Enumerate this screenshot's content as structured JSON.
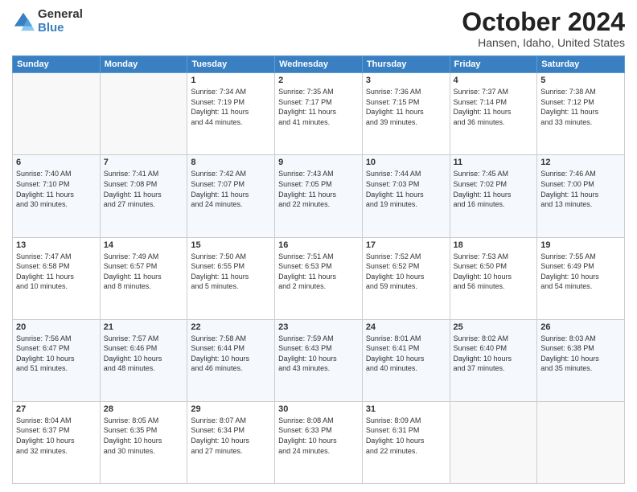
{
  "header": {
    "logo": {
      "general": "General",
      "blue": "Blue"
    },
    "title": "October 2024",
    "location": "Hansen, Idaho, United States"
  },
  "weekdays": [
    "Sunday",
    "Monday",
    "Tuesday",
    "Wednesday",
    "Thursday",
    "Friday",
    "Saturday"
  ],
  "weeks": [
    [
      {
        "day": "",
        "info": ""
      },
      {
        "day": "",
        "info": ""
      },
      {
        "day": "1",
        "info": "Sunrise: 7:34 AM\nSunset: 7:19 PM\nDaylight: 11 hours\nand 44 minutes."
      },
      {
        "day": "2",
        "info": "Sunrise: 7:35 AM\nSunset: 7:17 PM\nDaylight: 11 hours\nand 41 minutes."
      },
      {
        "day": "3",
        "info": "Sunrise: 7:36 AM\nSunset: 7:15 PM\nDaylight: 11 hours\nand 39 minutes."
      },
      {
        "day": "4",
        "info": "Sunrise: 7:37 AM\nSunset: 7:14 PM\nDaylight: 11 hours\nand 36 minutes."
      },
      {
        "day": "5",
        "info": "Sunrise: 7:38 AM\nSunset: 7:12 PM\nDaylight: 11 hours\nand 33 minutes."
      }
    ],
    [
      {
        "day": "6",
        "info": "Sunrise: 7:40 AM\nSunset: 7:10 PM\nDaylight: 11 hours\nand 30 minutes."
      },
      {
        "day": "7",
        "info": "Sunrise: 7:41 AM\nSunset: 7:08 PM\nDaylight: 11 hours\nand 27 minutes."
      },
      {
        "day": "8",
        "info": "Sunrise: 7:42 AM\nSunset: 7:07 PM\nDaylight: 11 hours\nand 24 minutes."
      },
      {
        "day": "9",
        "info": "Sunrise: 7:43 AM\nSunset: 7:05 PM\nDaylight: 11 hours\nand 22 minutes."
      },
      {
        "day": "10",
        "info": "Sunrise: 7:44 AM\nSunset: 7:03 PM\nDaylight: 11 hours\nand 19 minutes."
      },
      {
        "day": "11",
        "info": "Sunrise: 7:45 AM\nSunset: 7:02 PM\nDaylight: 11 hours\nand 16 minutes."
      },
      {
        "day": "12",
        "info": "Sunrise: 7:46 AM\nSunset: 7:00 PM\nDaylight: 11 hours\nand 13 minutes."
      }
    ],
    [
      {
        "day": "13",
        "info": "Sunrise: 7:47 AM\nSunset: 6:58 PM\nDaylight: 11 hours\nand 10 minutes."
      },
      {
        "day": "14",
        "info": "Sunrise: 7:49 AM\nSunset: 6:57 PM\nDaylight: 11 hours\nand 8 minutes."
      },
      {
        "day": "15",
        "info": "Sunrise: 7:50 AM\nSunset: 6:55 PM\nDaylight: 11 hours\nand 5 minutes."
      },
      {
        "day": "16",
        "info": "Sunrise: 7:51 AM\nSunset: 6:53 PM\nDaylight: 11 hours\nand 2 minutes."
      },
      {
        "day": "17",
        "info": "Sunrise: 7:52 AM\nSunset: 6:52 PM\nDaylight: 10 hours\nand 59 minutes."
      },
      {
        "day": "18",
        "info": "Sunrise: 7:53 AM\nSunset: 6:50 PM\nDaylight: 10 hours\nand 56 minutes."
      },
      {
        "day": "19",
        "info": "Sunrise: 7:55 AM\nSunset: 6:49 PM\nDaylight: 10 hours\nand 54 minutes."
      }
    ],
    [
      {
        "day": "20",
        "info": "Sunrise: 7:56 AM\nSunset: 6:47 PM\nDaylight: 10 hours\nand 51 minutes."
      },
      {
        "day": "21",
        "info": "Sunrise: 7:57 AM\nSunset: 6:46 PM\nDaylight: 10 hours\nand 48 minutes."
      },
      {
        "day": "22",
        "info": "Sunrise: 7:58 AM\nSunset: 6:44 PM\nDaylight: 10 hours\nand 46 minutes."
      },
      {
        "day": "23",
        "info": "Sunrise: 7:59 AM\nSunset: 6:43 PM\nDaylight: 10 hours\nand 43 minutes."
      },
      {
        "day": "24",
        "info": "Sunrise: 8:01 AM\nSunset: 6:41 PM\nDaylight: 10 hours\nand 40 minutes."
      },
      {
        "day": "25",
        "info": "Sunrise: 8:02 AM\nSunset: 6:40 PM\nDaylight: 10 hours\nand 37 minutes."
      },
      {
        "day": "26",
        "info": "Sunrise: 8:03 AM\nSunset: 6:38 PM\nDaylight: 10 hours\nand 35 minutes."
      }
    ],
    [
      {
        "day": "27",
        "info": "Sunrise: 8:04 AM\nSunset: 6:37 PM\nDaylight: 10 hours\nand 32 minutes."
      },
      {
        "day": "28",
        "info": "Sunrise: 8:05 AM\nSunset: 6:35 PM\nDaylight: 10 hours\nand 30 minutes."
      },
      {
        "day": "29",
        "info": "Sunrise: 8:07 AM\nSunset: 6:34 PM\nDaylight: 10 hours\nand 27 minutes."
      },
      {
        "day": "30",
        "info": "Sunrise: 8:08 AM\nSunset: 6:33 PM\nDaylight: 10 hours\nand 24 minutes."
      },
      {
        "day": "31",
        "info": "Sunrise: 8:09 AM\nSunset: 6:31 PM\nDaylight: 10 hours\nand 22 minutes."
      },
      {
        "day": "",
        "info": ""
      },
      {
        "day": "",
        "info": ""
      }
    ]
  ]
}
